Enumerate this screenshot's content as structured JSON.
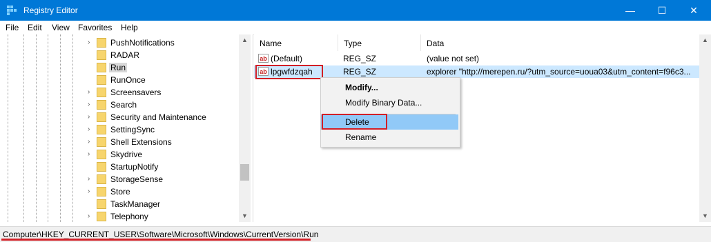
{
  "window": {
    "title": "Registry Editor",
    "minimize": "—",
    "maximize": "☐",
    "close": "✕"
  },
  "menu": [
    "File",
    "Edit",
    "View",
    "Favorites",
    "Help"
  ],
  "tree": {
    "items": [
      {
        "label": "PushNotifications",
        "expandable": true
      },
      {
        "label": "RADAR",
        "expandable": false
      },
      {
        "label": "Run",
        "expandable": false,
        "selected": true
      },
      {
        "label": "RunOnce",
        "expandable": false
      },
      {
        "label": "Screensavers",
        "expandable": true
      },
      {
        "label": "Search",
        "expandable": true
      },
      {
        "label": "Security and Maintenance",
        "expandable": true
      },
      {
        "label": "SettingSync",
        "expandable": true
      },
      {
        "label": "Shell Extensions",
        "expandable": true
      },
      {
        "label": "Skydrive",
        "expandable": true
      },
      {
        "label": "StartupNotify",
        "expandable": false
      },
      {
        "label": "StorageSense",
        "expandable": true
      },
      {
        "label": "Store",
        "expandable": true
      },
      {
        "label": "TaskManager",
        "expandable": false
      },
      {
        "label": "Telephony",
        "expandable": true
      }
    ]
  },
  "list": {
    "columns": [
      "Name",
      "Type",
      "Data"
    ],
    "rows": [
      {
        "name": "(Default)",
        "type": "REG_SZ",
        "data": "(value not set)"
      },
      {
        "name": "lpgwfdzqah",
        "type": "REG_SZ",
        "data": "explorer \"http://merepen.ru/?utm_source=uoua03&utm_content=f96c3..."
      }
    ]
  },
  "context_menu": {
    "modify": "Modify...",
    "modify_binary": "Modify Binary Data...",
    "delete": "Delete",
    "rename": "Rename"
  },
  "status": {
    "path": "Computer\\HKEY_CURRENT_USER\\Software\\Microsoft\\Windows\\CurrentVersion\\Run"
  },
  "colors": {
    "titlebar": "#0078d7",
    "highlight": "#cce8ff",
    "annotation": "#d21f26"
  },
  "icons": {
    "app": "registry-cubes-icon",
    "folder": "folder-icon",
    "value": "string-value-ab-icon"
  }
}
